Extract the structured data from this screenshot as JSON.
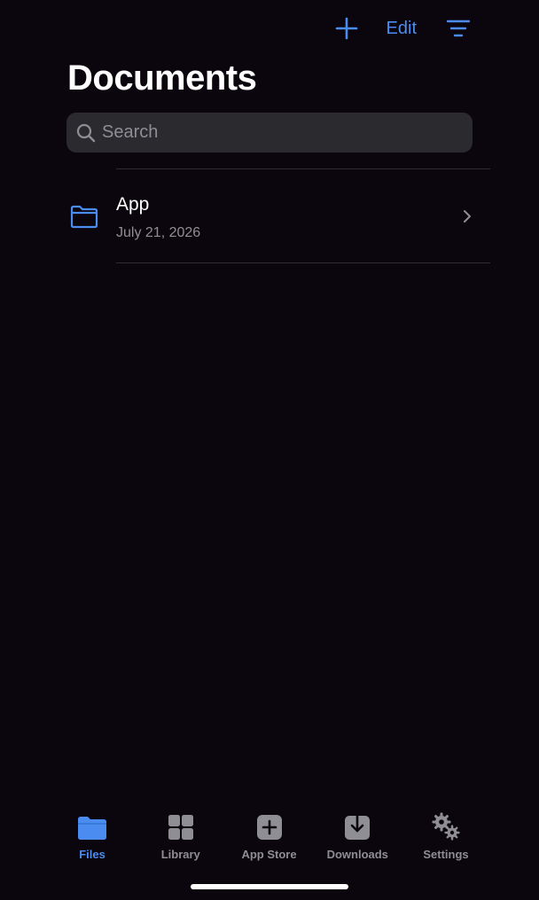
{
  "toolbar": {
    "add_icon": "plus-icon",
    "edit_label": "Edit",
    "sort_icon": "sort-lines-icon",
    "accent_color": "#4a8cf0"
  },
  "page": {
    "title": "Documents"
  },
  "search": {
    "placeholder": "Search",
    "value": "",
    "icon": "magnifying-glass-icon"
  },
  "files": [
    {
      "name": "App",
      "date": "July 21, 2026",
      "icon": "folder-icon"
    }
  ],
  "tabbar": {
    "tabs": [
      {
        "label": "Files",
        "icon": "folder-filled-icon",
        "active": true
      },
      {
        "label": "Library",
        "icon": "grid-icon",
        "active": false
      },
      {
        "label": "App Store",
        "icon": "plus-square-icon",
        "active": false
      },
      {
        "label": "Downloads",
        "icon": "download-tray-icon",
        "active": false
      },
      {
        "label": "Settings",
        "icon": "gears-icon",
        "active": false
      }
    ],
    "active_color": "#4a8cf0",
    "inactive_color": "#8f8e94"
  },
  "theme": {
    "background": "#0b060d",
    "search_background": "#2b2a2f",
    "secondary_text": "#8f8e94"
  }
}
